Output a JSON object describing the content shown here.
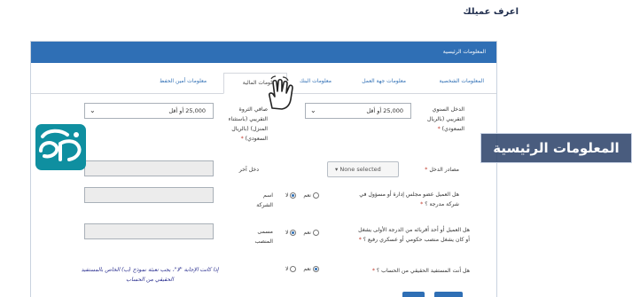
{
  "page": {
    "heading": "اعرف عميلك"
  },
  "panel": {
    "title": "المعلومات الرئيسية"
  },
  "tabs": [
    {
      "label": "المعلومات الشخصية",
      "active": false
    },
    {
      "label": "معلومات جهة العمل",
      "active": false
    },
    {
      "label": "معلومات البنك",
      "active": false
    },
    {
      "label": "المعلومات المالية",
      "active": true
    },
    {
      "label": "معلومات أمين الحفظ",
      "active": false
    }
  ],
  "form": {
    "annual_income": {
      "label_l1": "الدخل السنوي",
      "label_l2": "التقريبي (بالريال",
      "label_l3": "السعودي)",
      "value": "25,000 أو أقل"
    },
    "net_worth": {
      "label_l1": "صافي الثروة",
      "label_l2": "التقريبي (باستثناء",
      "label_l3": "المنزل) (بالريال",
      "label_l4": "السعودي)",
      "value": "25,000 أو أقل"
    },
    "income_sources": {
      "label": "مصادر الدخل",
      "value": "None selected"
    },
    "other_income": {
      "label": "دخل آخر",
      "value": ""
    },
    "q_board": {
      "label_l1": "هل العميل عضو مجلس إدارة أو مسؤول في",
      "label_l2": "شركة مدرجة ؟",
      "yes": "نعم",
      "no": "لا",
      "selected": "no"
    },
    "company_name": {
      "label_l1": "اسم",
      "label_l2": "الشركة",
      "value": ""
    },
    "q_relative": {
      "label_l1": "هل العميل أو أحد أقربائه من الدرجة الأولى يشغل",
      "label_l2": "أو كان يشغل منصب حكومي أو عسكري رفيع ؟",
      "yes": "نعم",
      "no": "لا",
      "selected": "no"
    },
    "position_title": {
      "label_l1": "مسمى",
      "label_l2": "المنصب",
      "value": ""
    },
    "q_beneficiary": {
      "label": "هل أنت المستفيد الحقيقي من الحساب ؟",
      "yes": "نعم",
      "no": "لا",
      "selected": "yes"
    },
    "note": {
      "line1": "إذا كانت الإجابة \"لا\"، يجب تعبئة نموذج (ب) الخاص بالمستفيد",
      "line2": "الحقيقي من الحساب"
    }
  },
  "required_mark": "*",
  "banner": {
    "text": "المعلومات الرئيسية"
  },
  "colors": {
    "accent": "#2f6fb5",
    "banner_bg": "#30466c",
    "logo_bg": "#0f8fa0",
    "required": "#c0392b"
  },
  "icons": {
    "pointer": "hand-pointer-icon",
    "dropdown": "caret-down-icon"
  }
}
